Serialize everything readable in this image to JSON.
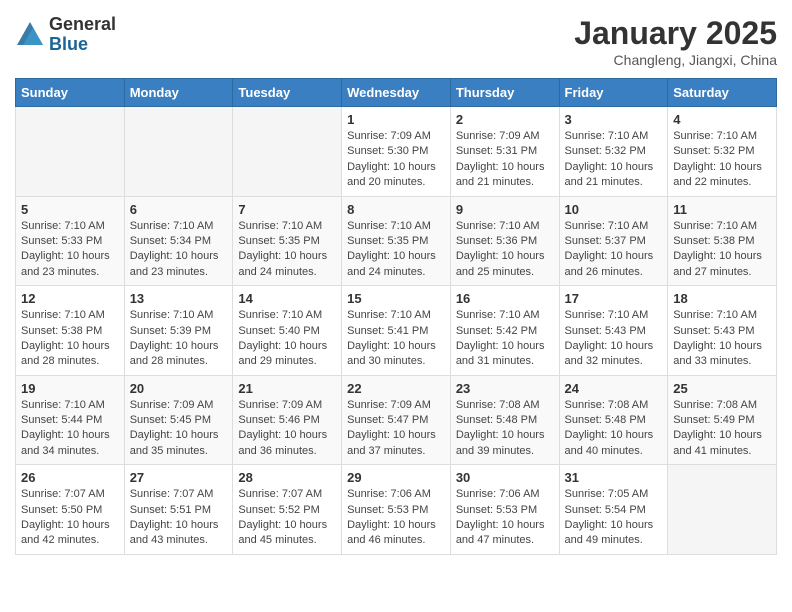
{
  "header": {
    "logo_line1": "General",
    "logo_line2": "Blue",
    "month_title": "January 2025",
    "location": "Changleng, Jiangxi, China"
  },
  "weekdays": [
    "Sunday",
    "Monday",
    "Tuesday",
    "Wednesday",
    "Thursday",
    "Friday",
    "Saturday"
  ],
  "weeks": [
    [
      {
        "day": "",
        "info": ""
      },
      {
        "day": "",
        "info": ""
      },
      {
        "day": "",
        "info": ""
      },
      {
        "day": "1",
        "info": "Sunrise: 7:09 AM\nSunset: 5:30 PM\nDaylight: 10 hours\nand 20 minutes."
      },
      {
        "day": "2",
        "info": "Sunrise: 7:09 AM\nSunset: 5:31 PM\nDaylight: 10 hours\nand 21 minutes."
      },
      {
        "day": "3",
        "info": "Sunrise: 7:10 AM\nSunset: 5:32 PM\nDaylight: 10 hours\nand 21 minutes."
      },
      {
        "day": "4",
        "info": "Sunrise: 7:10 AM\nSunset: 5:32 PM\nDaylight: 10 hours\nand 22 minutes."
      }
    ],
    [
      {
        "day": "5",
        "info": "Sunrise: 7:10 AM\nSunset: 5:33 PM\nDaylight: 10 hours\nand 23 minutes."
      },
      {
        "day": "6",
        "info": "Sunrise: 7:10 AM\nSunset: 5:34 PM\nDaylight: 10 hours\nand 23 minutes."
      },
      {
        "day": "7",
        "info": "Sunrise: 7:10 AM\nSunset: 5:35 PM\nDaylight: 10 hours\nand 24 minutes."
      },
      {
        "day": "8",
        "info": "Sunrise: 7:10 AM\nSunset: 5:35 PM\nDaylight: 10 hours\nand 24 minutes."
      },
      {
        "day": "9",
        "info": "Sunrise: 7:10 AM\nSunset: 5:36 PM\nDaylight: 10 hours\nand 25 minutes."
      },
      {
        "day": "10",
        "info": "Sunrise: 7:10 AM\nSunset: 5:37 PM\nDaylight: 10 hours\nand 26 minutes."
      },
      {
        "day": "11",
        "info": "Sunrise: 7:10 AM\nSunset: 5:38 PM\nDaylight: 10 hours\nand 27 minutes."
      }
    ],
    [
      {
        "day": "12",
        "info": "Sunrise: 7:10 AM\nSunset: 5:38 PM\nDaylight: 10 hours\nand 28 minutes."
      },
      {
        "day": "13",
        "info": "Sunrise: 7:10 AM\nSunset: 5:39 PM\nDaylight: 10 hours\nand 28 minutes."
      },
      {
        "day": "14",
        "info": "Sunrise: 7:10 AM\nSunset: 5:40 PM\nDaylight: 10 hours\nand 29 minutes."
      },
      {
        "day": "15",
        "info": "Sunrise: 7:10 AM\nSunset: 5:41 PM\nDaylight: 10 hours\nand 30 minutes."
      },
      {
        "day": "16",
        "info": "Sunrise: 7:10 AM\nSunset: 5:42 PM\nDaylight: 10 hours\nand 31 minutes."
      },
      {
        "day": "17",
        "info": "Sunrise: 7:10 AM\nSunset: 5:43 PM\nDaylight: 10 hours\nand 32 minutes."
      },
      {
        "day": "18",
        "info": "Sunrise: 7:10 AM\nSunset: 5:43 PM\nDaylight: 10 hours\nand 33 minutes."
      }
    ],
    [
      {
        "day": "19",
        "info": "Sunrise: 7:10 AM\nSunset: 5:44 PM\nDaylight: 10 hours\nand 34 minutes."
      },
      {
        "day": "20",
        "info": "Sunrise: 7:09 AM\nSunset: 5:45 PM\nDaylight: 10 hours\nand 35 minutes."
      },
      {
        "day": "21",
        "info": "Sunrise: 7:09 AM\nSunset: 5:46 PM\nDaylight: 10 hours\nand 36 minutes."
      },
      {
        "day": "22",
        "info": "Sunrise: 7:09 AM\nSunset: 5:47 PM\nDaylight: 10 hours\nand 37 minutes."
      },
      {
        "day": "23",
        "info": "Sunrise: 7:08 AM\nSunset: 5:48 PM\nDaylight: 10 hours\nand 39 minutes."
      },
      {
        "day": "24",
        "info": "Sunrise: 7:08 AM\nSunset: 5:48 PM\nDaylight: 10 hours\nand 40 minutes."
      },
      {
        "day": "25",
        "info": "Sunrise: 7:08 AM\nSunset: 5:49 PM\nDaylight: 10 hours\nand 41 minutes."
      }
    ],
    [
      {
        "day": "26",
        "info": "Sunrise: 7:07 AM\nSunset: 5:50 PM\nDaylight: 10 hours\nand 42 minutes."
      },
      {
        "day": "27",
        "info": "Sunrise: 7:07 AM\nSunset: 5:51 PM\nDaylight: 10 hours\nand 43 minutes."
      },
      {
        "day": "28",
        "info": "Sunrise: 7:07 AM\nSunset: 5:52 PM\nDaylight: 10 hours\nand 45 minutes."
      },
      {
        "day": "29",
        "info": "Sunrise: 7:06 AM\nSunset: 5:53 PM\nDaylight: 10 hours\nand 46 minutes."
      },
      {
        "day": "30",
        "info": "Sunrise: 7:06 AM\nSunset: 5:53 PM\nDaylight: 10 hours\nand 47 minutes."
      },
      {
        "day": "31",
        "info": "Sunrise: 7:05 AM\nSunset: 5:54 PM\nDaylight: 10 hours\nand 49 minutes."
      },
      {
        "day": "",
        "info": ""
      }
    ]
  ]
}
